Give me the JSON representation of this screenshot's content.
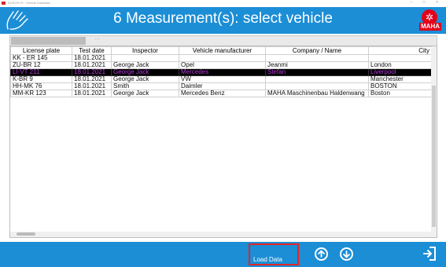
{
  "window": {
    "title_text": "EUROSYS - Vehicle Database",
    "controls": "– □ ×"
  },
  "header": {
    "title": "6 Measurement(s): select vehicle",
    "logo_text": "MAHA"
  },
  "filter": {
    "dots": ". ."
  },
  "table": {
    "columns": [
      "License plate",
      "Test date",
      "Inspector",
      "Vehicle manufacturer",
      "Company / Name",
      "City"
    ],
    "rows": [
      [
        "KK - ER 145",
        "18.01.2021",
        "",
        "",
        "",
        ""
      ],
      [
        "ZU-BR 12",
        "18.01.2021",
        "George Jack",
        "Opel",
        "Jeanmi",
        "London"
      ],
      [
        "LI-VT 211",
        "18.01.2021",
        "George Jack",
        "Mercedes",
        "Stefan",
        "Liverpool"
      ],
      [
        "K-BR 9",
        "18.01.2021",
        "George Jack",
        "VW",
        "",
        "Manchester"
      ],
      [
        "HH-MK 76",
        "18.01.2021",
        "Smith",
        "Daimler",
        "",
        "BOSTON"
      ],
      [
        "MM-KR 123",
        "18.01.2021",
        "George Jack",
        "Mercedes Benz",
        "MAHA Maschinenbau Haldenwang",
        "Boston"
      ]
    ],
    "selected_row": 2
  },
  "footer": {
    "load_label": "Load Data",
    "buttons": [
      "arrow-up",
      "arrow-down",
      "exit"
    ]
  },
  "colors": {
    "accent": "#1b8ed6",
    "highlight_border": "#e32525",
    "selected_text": "#b23ad6",
    "brand_red": "#e2001a"
  }
}
